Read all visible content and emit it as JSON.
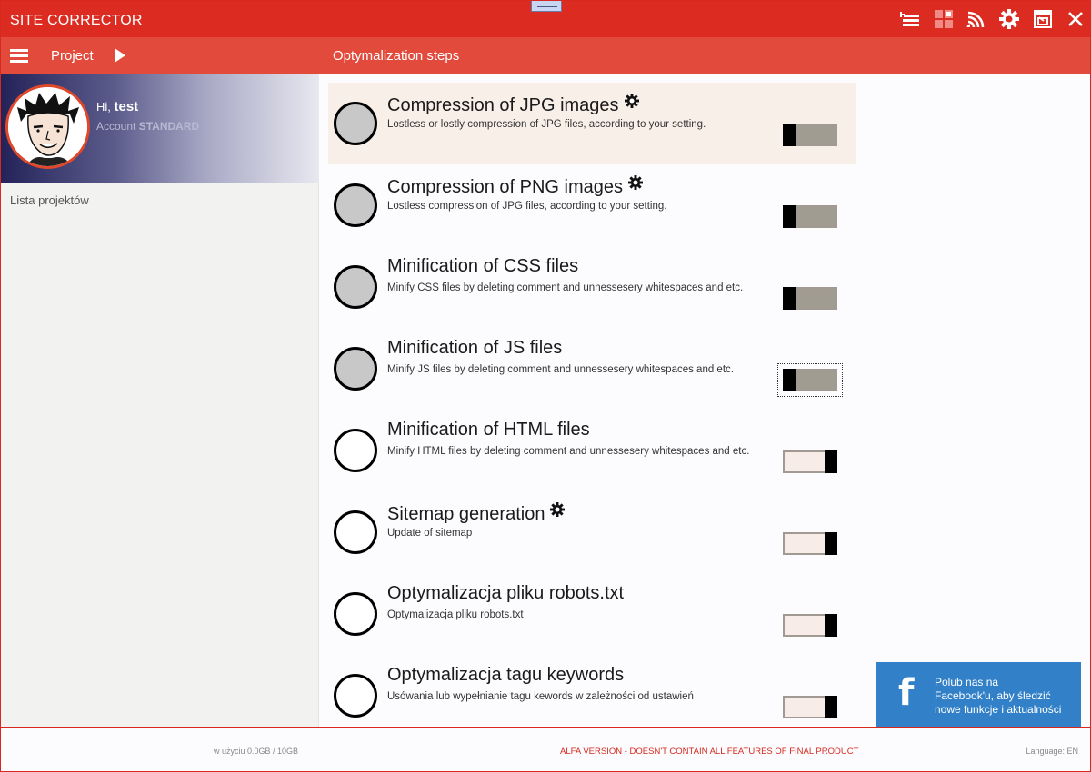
{
  "window": {
    "title": "SITE CORRECTOR",
    "toolbar_icons": [
      "list-add-icon",
      "grid-icon",
      "signal-icon",
      "gear-icon",
      "restore-window-icon",
      "close-icon"
    ]
  },
  "header": {
    "project_label": "Project",
    "section_title": "Optymalization steps"
  },
  "profile": {
    "greeting": "Hi,",
    "username": "test",
    "account_label": "Account",
    "account_type": "STANDARD"
  },
  "sidebar": {
    "projects_link": "Lista projektów"
  },
  "steps": [
    {
      "title": "Compression of JPG images",
      "desc": "Lostless or lostly compression of JPG files, according to your setting.",
      "enabled": true,
      "has_settings": true
    },
    {
      "title": "Compression of PNG images",
      "desc": "Lostless compression of JPG files, according to your setting.",
      "enabled": true,
      "has_settings": true
    },
    {
      "title": "Minification of CSS files",
      "desc": "Minify CSS files by deleting comment and unnessesery whitespaces and etc.",
      "enabled": true,
      "has_settings": false
    },
    {
      "title": "Minification of JS files",
      "desc": "Minify JS files by deleting comment and unnessesery whitespaces and etc.",
      "enabled": true,
      "has_settings": false
    },
    {
      "title": "Minification of HTML files",
      "desc": "Minify HTML files by deleting comment and unnessesery whitespaces and etc.",
      "enabled": false,
      "has_settings": false
    },
    {
      "title": "Sitemap generation",
      "desc": "Update of sitemap",
      "enabled": false,
      "has_settings": true
    },
    {
      "title": "Optymalizacja pliku robots.txt",
      "desc": "Optymalizacja pliku robots.txt",
      "enabled": false,
      "has_settings": false
    },
    {
      "title": "Optymalizacja tagu keywords",
      "desc": "Usówania lub wypełnianie tagu kewords w zależności od ustawień",
      "enabled": false,
      "has_settings": false
    }
  ],
  "facebook": {
    "logo": "f",
    "line1": "Polub nas na",
    "line2": "Facebook'u, aby śledzić",
    "line3": "nowe funkcje i aktualności"
  },
  "footer": {
    "usage": "w użyciu 0.0GB / 10GB",
    "notice": "ALFA VERSION - DOESN'T CONTAIN ALL FEATURES OF FINAL PRODUCT",
    "language": "Language: EN"
  },
  "colors": {
    "titlebar": "#dc2b20",
    "subheader": "#e24a3c",
    "facebook": "#3280c8",
    "toggle_on": "#a19c92",
    "toggle_off": "#f7ece8"
  }
}
